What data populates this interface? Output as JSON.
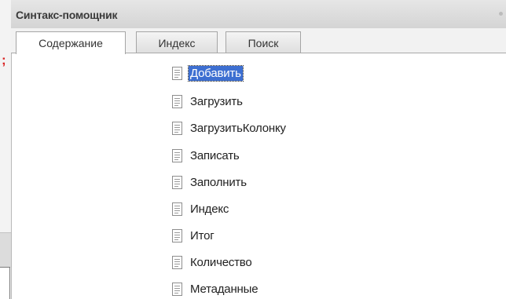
{
  "window": {
    "title": "Синтакс-помощник"
  },
  "tabs": [
    {
      "label": "Содержание",
      "active": true
    },
    {
      "label": "Индекс",
      "active": false
    },
    {
      "label": "Поиск",
      "active": false
    }
  ],
  "background_window": {
    "visible_fragment": ";"
  },
  "items": [
    {
      "label": "Добавить",
      "icon": "document-icon",
      "selected": true
    },
    {
      "label": "Загрузить",
      "icon": "document-icon",
      "selected": false
    },
    {
      "label": "ЗагрузитьКолонку",
      "icon": "document-icon",
      "selected": false
    },
    {
      "label": "Записать",
      "icon": "document-icon",
      "selected": false
    },
    {
      "label": "Заполнить",
      "icon": "document-icon",
      "selected": false
    },
    {
      "label": "Индекс",
      "icon": "document-icon",
      "selected": false
    },
    {
      "label": "Итог",
      "icon": "document-icon",
      "selected": false
    },
    {
      "label": "Количество",
      "icon": "document-icon",
      "selected": false
    },
    {
      "label": "Метаданные",
      "icon": "document-icon",
      "selected": false
    }
  ],
  "colors": {
    "selection": "#3d6fd1",
    "title_bar": "#d8d8d8",
    "accent_red": "#d92020"
  }
}
